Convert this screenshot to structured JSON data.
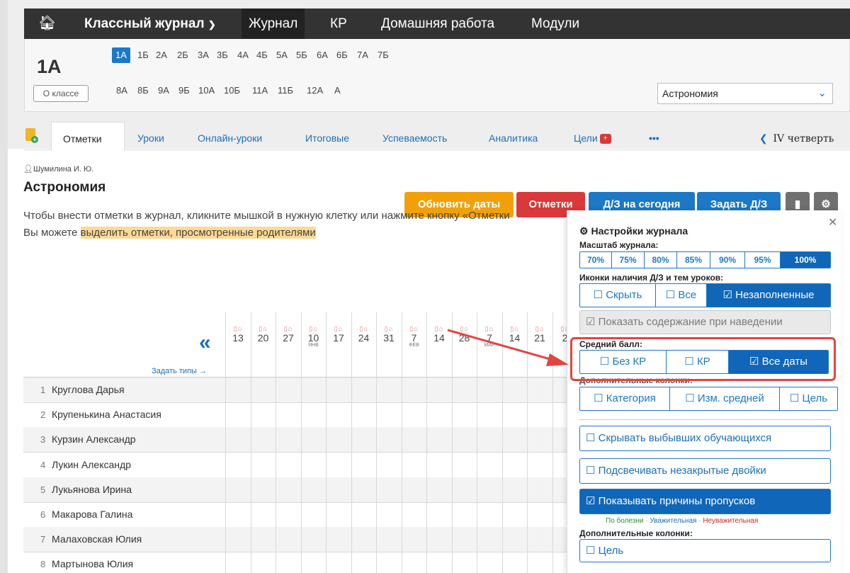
{
  "nav": {
    "home_icon": "home-icon",
    "journal_menu": "Классный журнал",
    "items": [
      "Журнал",
      "КР",
      "Домашняя работа",
      "Модули"
    ]
  },
  "class": {
    "title": "1А",
    "about": "О классе",
    "row1": [
      "1А",
      "1Б",
      "2А",
      "2Б",
      "3А",
      "3Б",
      "4А",
      "4Б",
      "5А",
      "5Б",
      "6А",
      "6Б",
      "7А",
      "7Б"
    ],
    "row2": [
      "8А",
      "8Б",
      "9А",
      "9Б",
      "10А",
      "10Б",
      "11А",
      "11Б",
      "12А",
      "А"
    ],
    "subject": "Астрономия"
  },
  "tabs": {
    "items": [
      "Отметки",
      "Уроки",
      "Онлайн-уроки",
      "Итоговые",
      "Успеваемость",
      "Аналитика",
      "Цели"
    ],
    "more": "•••",
    "quarter": "IV четверть"
  },
  "main": {
    "teacher": "Шумилина И. Ю.",
    "title": "Астрономия",
    "buttons": [
      "Обновить даты",
      "Отметки",
      "Д/З на сегодня",
      "Задать Д/З"
    ],
    "hint1": "Чтобы внести отметки в журнал, кликните мышкой в нужную клетку или нажмите кнопку «Отметки",
    "hint2_prefix": "Вы можете ",
    "hint2_link": "выделить отметки, просмотренные родителями",
    "set_types": "Задать типы →"
  },
  "dates": [
    {
      "d": "13",
      "m": ""
    },
    {
      "d": "20",
      "m": ""
    },
    {
      "d": "27",
      "m": ""
    },
    {
      "d": "10",
      "m": "ЯНВ"
    },
    {
      "d": "17",
      "m": ""
    },
    {
      "d": "24",
      "m": ""
    },
    {
      "d": "31",
      "m": ""
    },
    {
      "d": "7",
      "m": "ФЕВ"
    },
    {
      "d": "14",
      "m": ""
    },
    {
      "d": "28",
      "m": ""
    },
    {
      "d": "7",
      "m": "МАР"
    },
    {
      "d": "14",
      "m": ""
    },
    {
      "d": "21",
      "m": ""
    },
    {
      "d": "2",
      "m": ""
    }
  ],
  "students": [
    "Круглова Дарья",
    "Крупенькина Анастасия",
    "Курзин Александр",
    "Лукин Александр",
    "Лукьянова Ирина",
    "Макарова Галина",
    "Малаховская Юлия",
    "Мартынова Юлия"
  ],
  "settings": {
    "title": "Настройки журнала",
    "scale_label": "Масштаб журнала:",
    "scale": [
      "70%",
      "75%",
      "80%",
      "85%",
      "90%",
      "95%",
      "100%"
    ],
    "icons_label": "Иконки наличия Д/З и тем уроков:",
    "icons": [
      "Скрыть",
      "Все",
      "Незаполненные"
    ],
    "show_content": "Показать содержание при наведении",
    "avg_label": "Средний балл:",
    "avg": [
      "Без КР",
      "КР",
      "Все даты"
    ],
    "extra_label": "Дополнительные колонки:",
    "extra": [
      "Категория",
      "Изм. средней",
      "Цель"
    ],
    "hide_dropped": "Скрывать выбывших обучающихся",
    "highlight_twos": "Подсвечивать незакрытые двойки",
    "show_reasons": "Показывать причины пропусков",
    "legend": [
      "По болезни",
      "Уважительная",
      "Неуважительная"
    ],
    "extra_label2": "Дополнительные колонки:",
    "goal": "Цель"
  },
  "colors": {
    "nav_bg": "#333333",
    "accent": "#1d78c6",
    "orange": "#f0a10a",
    "red": "#d9393a",
    "highlight": "#ffd993"
  }
}
